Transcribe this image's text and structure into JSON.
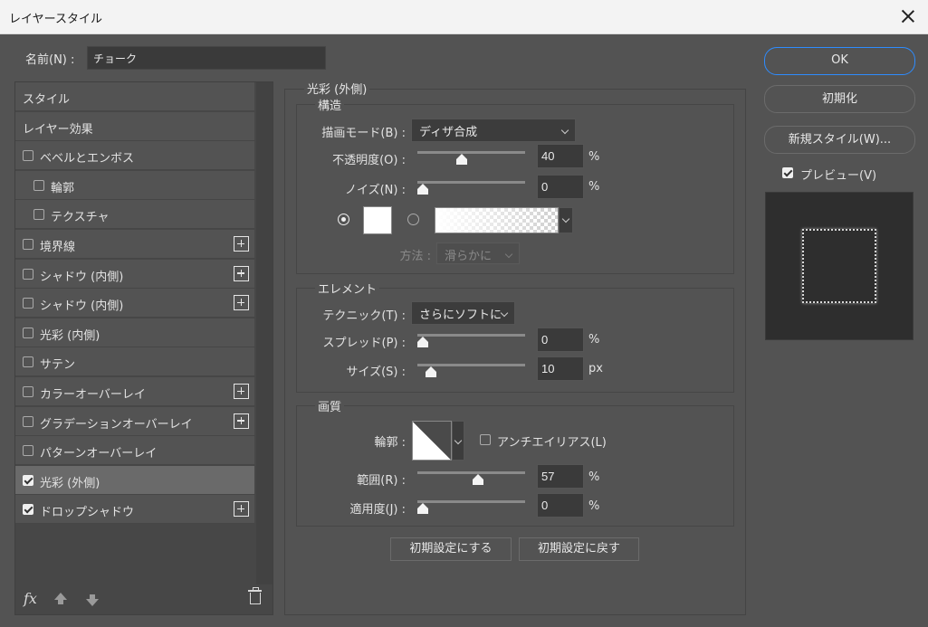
{
  "window": {
    "title": "レイヤースタイル"
  },
  "name": {
    "label": "名前(N) :",
    "value": "チョーク"
  },
  "style_list": {
    "items": [
      {
        "label": "スタイル",
        "checkbox": false,
        "checked": false,
        "plus": false,
        "indent": 0
      },
      {
        "label": "レイヤー効果",
        "checkbox": false,
        "checked": false,
        "plus": false,
        "indent": 0
      },
      {
        "label": "ベベルとエンボス",
        "checkbox": true,
        "checked": false,
        "plus": false,
        "indent": 0
      },
      {
        "label": "輪郭",
        "checkbox": true,
        "checked": false,
        "plus": false,
        "indent": 1
      },
      {
        "label": "テクスチャ",
        "checkbox": true,
        "checked": false,
        "plus": false,
        "indent": 1
      },
      {
        "label": "境界線",
        "checkbox": true,
        "checked": false,
        "plus": true,
        "indent": 0
      },
      {
        "label": "シャドウ (内側)",
        "checkbox": true,
        "checked": false,
        "plus": true,
        "indent": 0
      },
      {
        "label": "シャドウ (内側)",
        "checkbox": true,
        "checked": false,
        "plus": true,
        "indent": 0
      },
      {
        "label": "光彩 (内側)",
        "checkbox": true,
        "checked": false,
        "plus": false,
        "indent": 0
      },
      {
        "label": "サテン",
        "checkbox": true,
        "checked": false,
        "plus": false,
        "indent": 0
      },
      {
        "label": "カラーオーバーレイ",
        "checkbox": true,
        "checked": false,
        "plus": true,
        "indent": 0
      },
      {
        "label": "グラデーションオーバーレイ",
        "checkbox": true,
        "checked": false,
        "plus": true,
        "indent": 0
      },
      {
        "label": "パターンオーバーレイ",
        "checkbox": true,
        "checked": false,
        "plus": false,
        "indent": 0
      },
      {
        "label": "光彩 (外側)",
        "checkbox": true,
        "checked": true,
        "plus": false,
        "indent": 0,
        "selected": true
      },
      {
        "label": "ドロップシャドウ",
        "checkbox": true,
        "checked": true,
        "plus": true,
        "indent": 0
      }
    ],
    "footer_fx": "fx"
  },
  "panel": {
    "title": "光彩 (外側)",
    "structure": {
      "title": "構造",
      "blend_mode": {
        "label": "描画モード(B) :",
        "value": "ディザ合成"
      },
      "opacity": {
        "label": "不透明度(O) :",
        "value": "40",
        "unit": "%",
        "level": 0.4
      },
      "noise": {
        "label": "ノイズ(N) :",
        "value": "0",
        "unit": "%",
        "level": 0.0
      },
      "method": {
        "label": "方法 :",
        "value": "滑らかに"
      }
    },
    "elements": {
      "title": "エレメント",
      "technique": {
        "label": "テクニック(T) :",
        "value": "さらにソフトに"
      },
      "spread": {
        "label": "スプレッド(P) :",
        "value": "0",
        "unit": "%",
        "level": 0.0
      },
      "size": {
        "label": "サイズ(S) :",
        "value": "10",
        "unit": "px",
        "level": 0.08
      }
    },
    "quality": {
      "title": "画質",
      "contour": {
        "label": "輪郭 :"
      },
      "antialias": {
        "label": "アンチエイリアス(L)",
        "checked": false
      },
      "range": {
        "label": "範囲(R) :",
        "value": "57",
        "unit": "%",
        "level": 0.57
      },
      "jitter": {
        "label": "適用度(J) :",
        "value": "0",
        "unit": "%",
        "level": 0.0
      }
    },
    "buttons": {
      "make_default": "初期設定にする",
      "reset_default": "初期設定に戻す"
    }
  },
  "right": {
    "ok": "OK",
    "reset": "初期化",
    "new_style": "新規スタイル(W)...",
    "preview": {
      "label": "プレビュー(V)",
      "checked": true
    }
  },
  "colors": {
    "accent": "#2e8cff",
    "dialog_bg": "#535353"
  }
}
